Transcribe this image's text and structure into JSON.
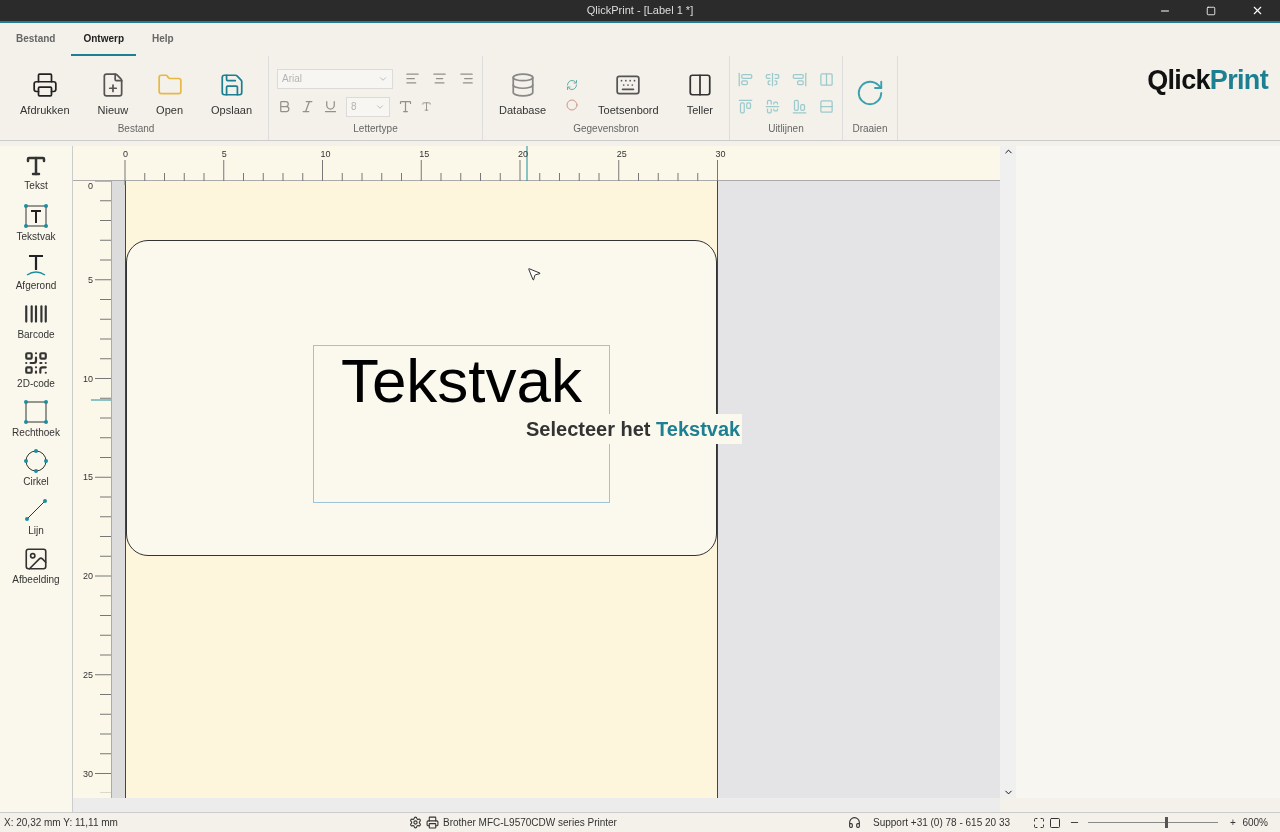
{
  "window": {
    "title": "QlickPrint - [Label 1 *]"
  },
  "tabs": [
    {
      "label": "Bestand",
      "selected": false
    },
    {
      "label": "Ontwerp",
      "selected": true
    },
    {
      "label": "Help",
      "selected": false
    }
  ],
  "ribbon": {
    "groups": [
      {
        "kind": "file",
        "label": "Bestand",
        "buttons": [
          "Afdrukken",
          "Nieuw",
          "Open",
          "Opslaan"
        ]
      },
      {
        "kind": "font",
        "label": "Lettertype",
        "font": {
          "value": "Arial"
        },
        "size": {
          "value": "8"
        },
        "disabled": true
      },
      {
        "kind": "data",
        "label": "Gegevensbron",
        "buttons": [
          "Database",
          "Toetsenbord",
          "Teller"
        ]
      },
      {
        "kind": "align",
        "label": "Uitlijnen",
        "disabled": true
      },
      {
        "kind": "rotate",
        "label": "Draaien"
      }
    ],
    "logo": {
      "part1": "Qlick",
      "part2": "Print"
    }
  },
  "tools": [
    {
      "kind": "text",
      "label": "Tekst"
    },
    {
      "kind": "textbox",
      "label": "Tekstvak"
    },
    {
      "kind": "curved",
      "label": "Afgerond"
    },
    {
      "kind": "barcode",
      "label": "Barcode"
    },
    {
      "kind": "qr",
      "label": "2D-code"
    },
    {
      "kind": "rect",
      "label": "Rechthoek"
    },
    {
      "kind": "circle",
      "label": "Cirkel"
    },
    {
      "kind": "line",
      "label": "Lijn"
    },
    {
      "kind": "image",
      "label": "Afbeelding"
    }
  ],
  "ruler": {
    "horizontal": [
      "0",
      "5",
      "10",
      "15",
      "20",
      "25",
      "30"
    ],
    "vertical": [
      "0",
      "5",
      "10",
      "15",
      "20",
      "25",
      "30"
    ]
  },
  "canvas": {
    "textbox": {
      "text": "Tekstvak"
    },
    "tooltip": {
      "prefix": "Selecteer het",
      "highlight": "Tekstvak"
    }
  },
  "status_bar": {
    "coordinates": "X: 20,32 mm Y: 11,11 mm",
    "printer": "Brother MFC-L9570CDW series Printer",
    "support": "Support +31 (0) 78 - 615 20 33",
    "zoom": {
      "level": 0.6,
      "reading": "600%",
      "zoom_in": "+"
    }
  }
}
